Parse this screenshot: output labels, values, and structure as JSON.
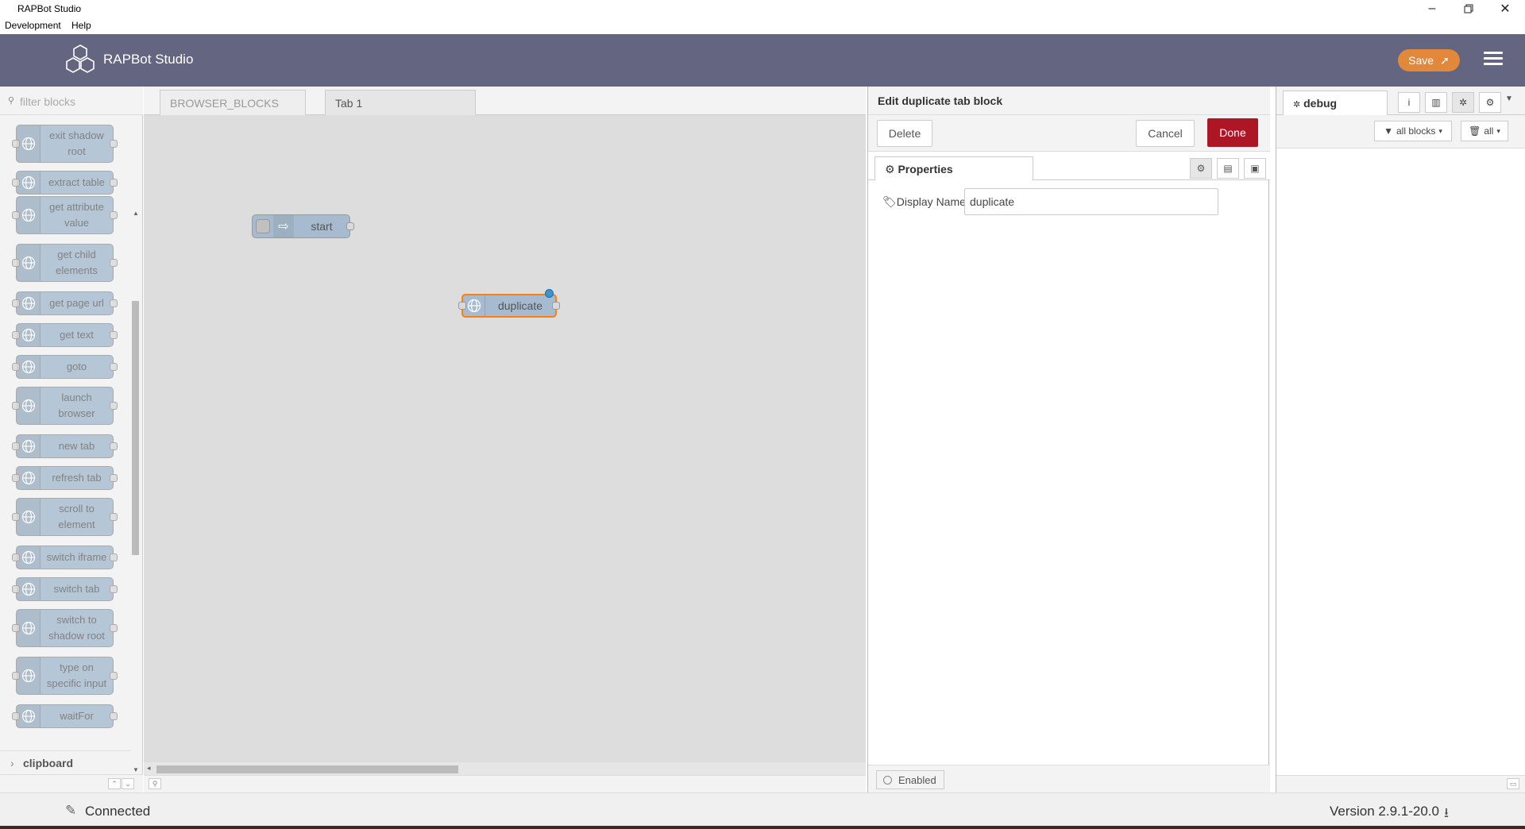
{
  "window": {
    "title": "RAPBot Studio"
  },
  "menu": {
    "items": [
      "Development",
      "Help"
    ]
  },
  "header": {
    "app_name": "RAPBot Studio",
    "save_label": "Save"
  },
  "palette": {
    "filter_placeholder": "filter blocks",
    "nodes": [
      {
        "label": "exit shadow root"
      },
      {
        "label": "extract table"
      },
      {
        "label": "get attribute value"
      },
      {
        "label": "get child elements"
      },
      {
        "label": "get page url"
      },
      {
        "label": "get text"
      },
      {
        "label": "goto"
      },
      {
        "label": "launch browser"
      },
      {
        "label": "new tab"
      },
      {
        "label": "refresh tab"
      },
      {
        "label": "scroll to element"
      },
      {
        "label": "switch iframe"
      },
      {
        "label": "switch tab"
      },
      {
        "label": "switch to shadow root"
      },
      {
        "label": "type on specific input"
      },
      {
        "label": "waitFor"
      }
    ],
    "category": "clipboard"
  },
  "workspace": {
    "tabs": [
      "BROWSER_BLOCKS",
      "Tab 1"
    ],
    "active_tab": "Tab 1",
    "nodes": {
      "start": "start",
      "duplicate": "duplicate"
    }
  },
  "editor": {
    "title": "Edit duplicate tab block",
    "delete_label": "Delete",
    "cancel_label": "Cancel",
    "done_label": "Done",
    "properties_tab": "Properties",
    "display_name_label": "Display Name",
    "display_name_value": "duplicate",
    "enabled_label": "Enabled"
  },
  "sidebar": {
    "active_tab": "debug",
    "filter_label": "all blocks",
    "clear_label": "all"
  },
  "status": {
    "connection": "Connected",
    "version": "Version 2.9.1-20.0"
  },
  "colors": {
    "header": "#646580",
    "save": "#e2883a",
    "done": "#ad1625",
    "node": "#a6bbcf"
  }
}
